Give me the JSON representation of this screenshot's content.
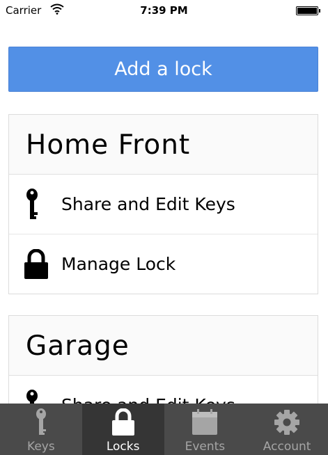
{
  "status_bar": {
    "carrier": "Carrier",
    "time": "7:39 PM"
  },
  "add_lock_label": "Add a lock",
  "locks": [
    {
      "name": "Home Front",
      "share_label": "Share and Edit Keys",
      "manage_label": "Manage Lock"
    },
    {
      "name": "Garage",
      "share_label": "Share and Edit Keys"
    }
  ],
  "tabs": [
    {
      "label": "Keys",
      "icon": "key-icon",
      "active": false
    },
    {
      "label": "Locks",
      "icon": "lock-icon",
      "active": true
    },
    {
      "label": "Events",
      "icon": "calendar-icon",
      "active": false
    },
    {
      "label": "Account",
      "icon": "gear-icon",
      "active": false
    }
  ],
  "colors": {
    "accent": "#5290e6",
    "tabbar": "#4a4a4a",
    "tab_active": "#353535"
  }
}
